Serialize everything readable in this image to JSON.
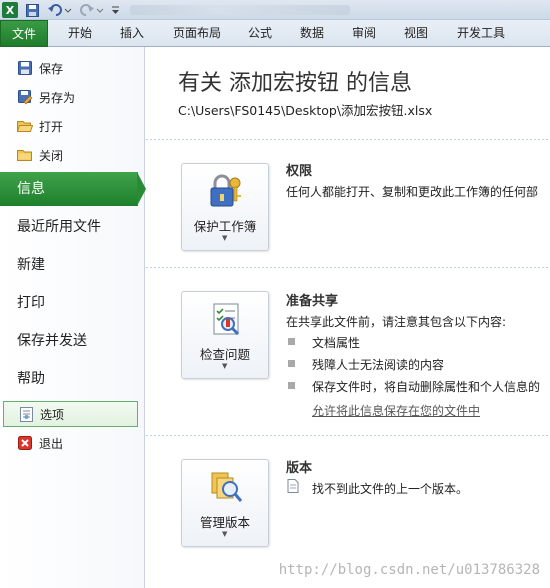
{
  "titlebar": {
    "excel_icon": "X"
  },
  "ribbon_tabs": [
    "文件",
    "开始",
    "插入",
    "页面布局",
    "公式",
    "数据",
    "审阅",
    "视图",
    "开发工具"
  ],
  "backstage": {
    "commands": [
      {
        "label": "保存",
        "icon": "save-icon"
      },
      {
        "label": "另存为",
        "icon": "save-as-icon"
      },
      {
        "label": "打开",
        "icon": "open-folder-icon"
      },
      {
        "label": "关闭",
        "icon": "close-folder-icon"
      }
    ],
    "nav": [
      "信息",
      "最近所用文件",
      "新建",
      "打印",
      "保存并发送",
      "帮助"
    ],
    "bottom_commands": [
      {
        "label": "选项",
        "icon": "options-icon"
      },
      {
        "label": "退出",
        "icon": "exit-icon"
      }
    ]
  },
  "info": {
    "title": "有关 添加宏按钮 的信息",
    "path": "C:\\Users\\FS0145\\Desktop\\添加宏按钮.xlsx",
    "permissions": {
      "button": "保护工作簿",
      "title": "权限",
      "desc": "任何人都能打开、复制和更改此工作簿的任何部"
    },
    "prepare": {
      "button": "检查问题",
      "title": "准备共享",
      "desc": "在共享此文件前，请注意其包含以下内容:",
      "bullets": [
        "文档属性",
        "残障人士无法阅读的内容",
        "保存文件时，将自动删除属性和个人信息的"
      ],
      "link": "允许将此信息保存在您的文件中"
    },
    "versions": {
      "button": "管理版本",
      "title": "版本",
      "desc": "找不到此文件的上一个版本。"
    }
  },
  "watermark": "http://blog.csdn.net/u013786328",
  "colors": {
    "file_tab": "#1f7c2b",
    "selected_nav": "#2a8b36",
    "annotation_arrow": "#d9201f"
  }
}
